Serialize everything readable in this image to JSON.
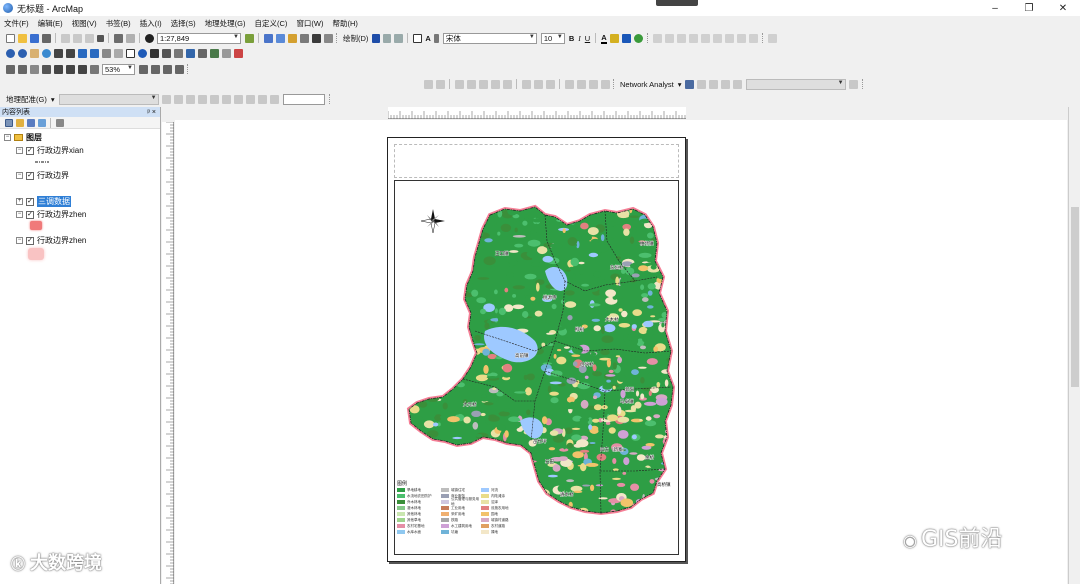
{
  "window": {
    "title": "无标题 - ArcMap"
  },
  "menu": [
    "文件(F)",
    "编辑(E)",
    "视图(V)",
    "书签(B)",
    "插入(I)",
    "选择(S)",
    "地理处理(G)",
    "自定义(C)",
    "窗口(W)",
    "帮助(H)"
  ],
  "toolbar": {
    "scale_value": "1:27,849",
    "drawing_label": "绘制(D)",
    "font_name": "宋体",
    "font_size": "10",
    "bold": "B",
    "italic": "I",
    "underline": "U",
    "font_color": "A",
    "zoom_value": "53%",
    "network_analyst": "Network Analyst",
    "georef_label": "地理配准(G)"
  },
  "toc": {
    "title": "内容列表",
    "pin": "ᵖ ×",
    "layers_group": "图层",
    "layers": [
      {
        "name": "行政边界xian",
        "checked": true
      },
      {
        "name": "行政边界",
        "checked": true
      },
      {
        "name": "三调数据",
        "checked": true,
        "selected": true
      },
      {
        "name": "行政边界zhen",
        "checked": true
      },
      {
        "name": "行政边界zhen",
        "checked": true
      }
    ]
  },
  "map": {
    "legend_title": "图例",
    "legend_items": [
      {
        "label": "旱地耕地",
        "color": "#2e9e45"
      },
      {
        "label": "水浇地农田防护",
        "color": "#4cbf6e"
      },
      {
        "label": "乔木林地",
        "color": "#3a8f3a"
      },
      {
        "label": "灌木林地",
        "color": "#86c98a"
      },
      {
        "label": "其他林地",
        "color": "#c9e6b0"
      },
      {
        "label": "其他草地",
        "color": "#9ed48c"
      },
      {
        "label": "农村宅基地",
        "color": "#e58fa6"
      },
      {
        "label": "水库水面",
        "color": "#8fc8f0"
      },
      {
        "label": "城镇住宅",
        "color": "#bdbdbd"
      },
      {
        "label": "商业服务",
        "color": "#9aa0b4"
      },
      {
        "label": "公共管理与服务用地",
        "color": "#d0c6e0"
      },
      {
        "label": "工业用地",
        "color": "#c77a5a"
      },
      {
        "label": "采矿用地",
        "color": "#f0b070"
      },
      {
        "label": "铁路",
        "color": "#a7a7a7"
      },
      {
        "label": "水工建筑用地",
        "color": "#cfa1d6"
      },
      {
        "label": "坑塘",
        "color": "#6fb3d8"
      },
      {
        "label": "河流",
        "color": "#9ec9ff"
      },
      {
        "label": "内陆滩涂",
        "color": "#e9dc8a"
      },
      {
        "label": "沼泽",
        "color": "#e8e2a6"
      },
      {
        "label": "设施农用地",
        "color": "#e28080"
      },
      {
        "label": "园地",
        "color": "#f2c36b"
      },
      {
        "label": "城镇村道路",
        "color": "#d7a9c4"
      },
      {
        "label": "农村道路",
        "color": "#e0a060"
      },
      {
        "label": "裸地",
        "color": "#f3e7c8"
      }
    ],
    "place_labels": [
      "王口镇",
      "柏场镇",
      "东垣村",
      "桃源寺",
      "大木村",
      "柳树",
      "高前镇",
      "后坪村",
      "大元村",
      "新阳",
      "马卓镇",
      "四方（新寨）",
      "金桥",
      "苗竹坪",
      "石田",
      "清水村",
      "高桥镇"
    ]
  },
  "watermarks": {
    "left": "大数跨境",
    "right": "GIS前沿"
  }
}
